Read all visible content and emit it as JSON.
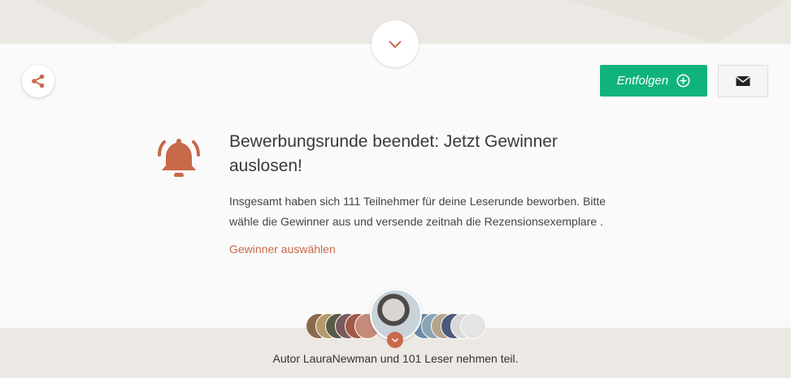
{
  "actions": {
    "follow_label": "Entfolgen"
  },
  "notice": {
    "title": "Bewerbungsrunde beendet: Jetzt Gewinner auslosen!",
    "description": "Insgesamt haben sich 111 Teilnehmer für deine Leserunde beworben. Bitte wähle die Gewinner aus und versende zeitnah die Rezensionsexemplare .",
    "link_label": "Gewinner auswählen"
  },
  "participants": {
    "summary": "Autor LauraNewman und 101 Leser nehmen teil."
  },
  "icons": {
    "collapse": "chevron-down-icon",
    "share": "share-icon",
    "follow": "plus-circle-icon",
    "mail": "envelope-icon",
    "notice": "bell-ringing-icon",
    "expand": "chevron-down-icon"
  },
  "colors": {
    "accent": "#c8694a",
    "follow_button": "#10b47a",
    "background": "#fafafa",
    "band": "#ece8e3"
  }
}
